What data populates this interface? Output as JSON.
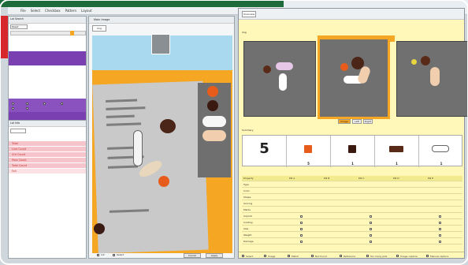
{
  "menu": [
    "File",
    "Select",
    "Checkbox",
    "Pattern",
    "Layout"
  ],
  "left_top": {
    "title": "Lot Search",
    "tool": "Reset"
  },
  "left_bottom": {
    "title": "Lot Info",
    "rows": [
      "Total",
      "Line Count",
      "Ctrl Count",
      "Pass Count",
      "Total Count",
      "Fail"
    ]
  },
  "middle": {
    "title": "Main Image",
    "tab": "Img",
    "buttons": [
      "Cancel",
      "Apply"
    ],
    "footer_checks": [
      "Lot",
      "Select"
    ]
  },
  "right": {
    "tab": "Overview",
    "section_label": "Img",
    "view_buttons": [
      "Image",
      "Left",
      "Right"
    ],
    "summary_label": "Summary",
    "total_count": "5",
    "counts": [
      "5",
      "1",
      "1",
      "1",
      "1"
    ],
    "table_header": [
      "Property",
      "Pill A",
      "Pill B",
      "Pill C",
      "Pill D",
      "Pill E"
    ],
    "table_rows": [
      "Type",
      "Color",
      "Shape",
      "Scoring",
      "Marks",
      "Imprint",
      "Coating",
      "Size",
      "Weight",
      "Damage"
    ],
    "footer": [
      "Select",
      "Image",
      "Match",
      "Not found",
      "Reference",
      "Too many pills",
      "Image capture",
      "Manual capture"
    ]
  },
  "colors": {
    "purple": "#7a3fb0",
    "pink": "#f6c4cb",
    "orange": "#f5a623",
    "sky": "#a9d9ee",
    "yellow": "#fff8b8",
    "green": "#1d6b3a",
    "red": "#d7262c"
  }
}
